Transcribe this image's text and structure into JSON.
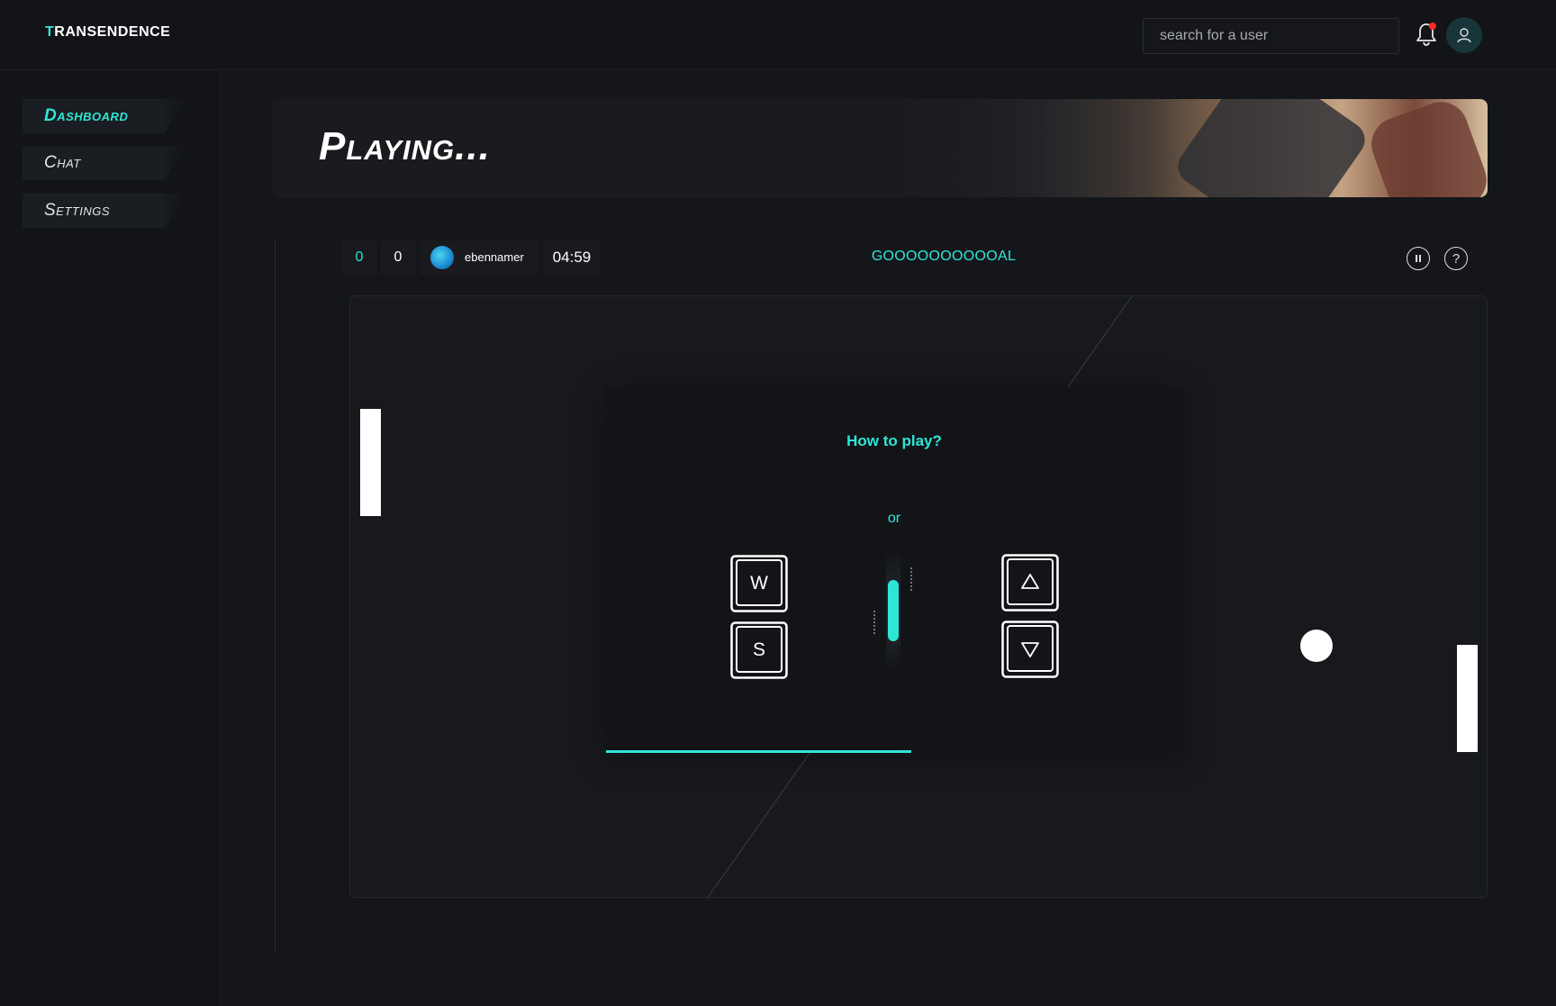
{
  "app": {
    "logo_first": "T",
    "logo_rest": "RANSENDENCE"
  },
  "header": {
    "search_placeholder": "search for a user",
    "notification_icon": "bell-icon",
    "avatar_icon": "user-icon"
  },
  "sidebar": {
    "items": [
      {
        "label": "Dashboard",
        "active": true
      },
      {
        "label": "Chat",
        "active": false
      },
      {
        "label": "Settings",
        "active": false
      }
    ]
  },
  "banner": {
    "title": "Playing..."
  },
  "game": {
    "score_left": "0",
    "score_right": "0",
    "player_name": "ebennamer",
    "timer": "04:59",
    "status": "GOOOOOOOOOOAL",
    "pause_icon": "pause-icon",
    "help_label": "?"
  },
  "modal": {
    "title": "How to play?",
    "or_label": "or",
    "key_up_left": "W",
    "key_down_left": "S",
    "key_up_right_icon": "arrow-up-icon",
    "key_down_right_icon": "arrow-down-icon",
    "progress": 0.53
  },
  "colors": {
    "accent": "#2ee6d6",
    "background": "#14161a",
    "notification_dot": "#ff2b2b"
  }
}
